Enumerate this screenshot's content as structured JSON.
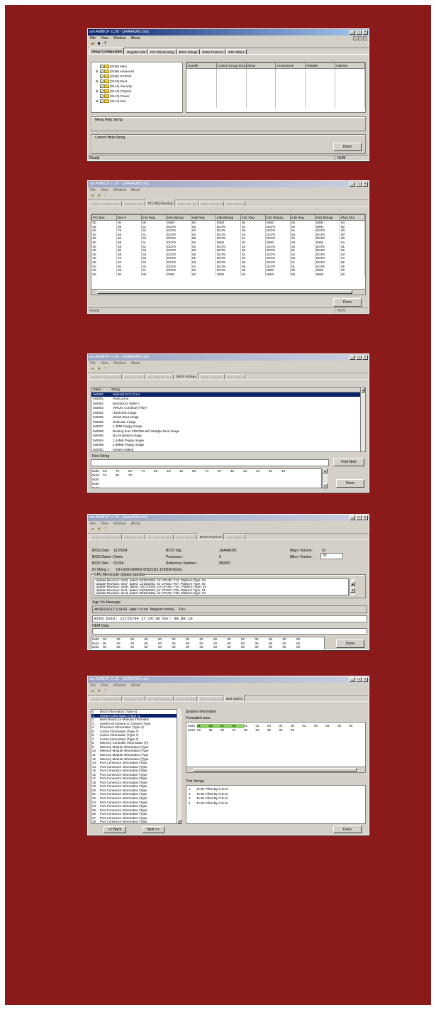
{
  "app": {
    "title": "ami AMIBCP v1.00 - [1AAAA000.rom]",
    "menu": [
      "File",
      "View",
      "Window",
      "About"
    ],
    "tabs": [
      "Setup Configuration",
      "Register Edit",
      "PCI IRQ Routing",
      "BIOS Strings",
      "BIOS Features",
      "DMI Tables"
    ],
    "status_ready": "Ready",
    "status_num": "NUM",
    "done_label": "Done"
  },
  "win1": {
    "active_tab": 0,
    "tree": [
      {
        "label": "(0190) Main",
        "checked": true
      },
      {
        "label": "(0196) Advanced",
        "checked": true
      },
      {
        "label": "(019F) PCIPnP",
        "checked": true
      },
      {
        "label": "(01A0) Boot",
        "checked": true
      },
      {
        "label": "(01A1) Security",
        "checked": true
      },
      {
        "label": "(01A2) Chipset",
        "checked": true
      },
      {
        "label": "(01A3) Power",
        "checked": true
      },
      {
        "label": "(01A4) Exit",
        "checked": true
      }
    ],
    "columns": [
      "Handle",
      "Control Group Structure",
      "Show",
      "Access/Use",
      "Failsafe",
      "Optimal"
    ],
    "menu_help_label": "Menu Help String",
    "control_help_label": "Control Help String"
  },
  "win2": {
    "active_tab": 2,
    "columns": [
      "PCI Bus",
      "Dev #",
      "IntA Reg",
      "IntA Bitmap",
      "IntB Reg",
      "IntB Bitmap",
      "IntC Reg",
      "IntC Bitmap",
      "IntD Reg",
      "IntD Bitmap",
      "Phys Slot"
    ],
    "rows": [
      [
        "00",
        "00",
        "00",
        "0000",
        "00",
        "0000",
        "00",
        "0000",
        "00",
        "0000",
        "00"
      ],
      [
        "00",
        "08",
        "01",
        "DCF8",
        "02",
        "DCF8",
        "03",
        "DCF8",
        "00",
        "0000",
        "00"
      ],
      [
        "00",
        "78",
        "02",
        "DCF8",
        "03",
        "DCF8",
        "05",
        "DCF8",
        "01",
        "DCF8",
        "00"
      ],
      [
        "00",
        "68",
        "01",
        "DCF8",
        "02",
        "DCF8",
        "03",
        "DCF8",
        "05",
        "DCF8",
        "00"
      ],
      [
        "00",
        "90",
        "03",
        "DCF8",
        "05",
        "DCF8",
        "01",
        "DCF8",
        "02",
        "DCF8",
        "00"
      ],
      [
        "00",
        "58",
        "01",
        "DCF8",
        "00",
        "0000",
        "00",
        "0000",
        "00",
        "0000",
        "00"
      ],
      [
        "00",
        "28",
        "01",
        "DCF8",
        "02",
        "DCF8",
        "03",
        "DCF8",
        "05",
        "DCF8",
        "01"
      ],
      [
        "00",
        "30",
        "02",
        "DCF8",
        "03",
        "DCF8",
        "05",
        "DCF8",
        "01",
        "DCF8",
        "02"
      ],
      [
        "00",
        "38",
        "03",
        "DCF8",
        "05",
        "DCF8",
        "01",
        "DCF8",
        "02",
        "DCF8",
        "03"
      ],
      [
        "00",
        "40",
        "05",
        "DCF8",
        "01",
        "DCF8",
        "02",
        "DCF8",
        "03",
        "DCF8",
        "04"
      ],
      [
        "00",
        "50",
        "02",
        "DCF8",
        "03",
        "DCF8",
        "05",
        "DCF8",
        "01",
        "DCF8",
        "05"
      ],
      [
        "00",
        "60",
        "02",
        "DCF8",
        "03",
        "DCF8",
        "05",
        "DCF8",
        "01",
        "DCF8",
        "05"
      ],
      [
        "00",
        "08",
        "01",
        "DCF8",
        "02",
        "DCF8",
        "00",
        "0000",
        "00",
        "0000",
        "00"
      ],
      [
        "00",
        "00",
        "00",
        "0000",
        "00",
        "0000",
        "00",
        "0000",
        "00",
        "0000",
        "00"
      ]
    ]
  },
  "win3": {
    "active_tab": 3,
    "columns": [
      "Token",
      "String"
    ],
    "strings": [
      [
        "0x0000",
        "Multi-Bit ECC Error"
      ],
      [
        "0x0001",
        "Parity Error"
      ],
      [
        "0x0002",
        "  BootSector Write !!"
      ],
      [
        "0x0003",
        "  VIRUS: Continue (Y/N)?"
      ],
      [
        "0x0004",
        "Hard Disk Image"
      ],
      [
        "0x0005",
        "Select Boot Image"
      ],
      [
        "0x0006",
        "Unknown Image"
      ],
      [
        "0x0007",
        "1.2MB Floppy Image"
      ],
      [
        "0x0008",
        "Booting from CDROM with Multiple Boot Image"
      ],
      [
        "0x0009",
        "No Emulation Image"
      ],
      [
        "0x000A",
        "1.44MB Floppy Image"
      ],
      [
        "0x000B",
        "2.88MB Floppy Image"
      ],
      [
        "0x000C",
        "System Halted"
      ],
      [
        "0x000D",
        "Reboot and Select proper Boot device or Insert Boot Media in selected Boot device and press a key"
      ],
      [
        "0x000E",
        "DRAM Frequency"
      ]
    ],
    "find_label": "Find String",
    "find_next_label": "Find Next",
    "hex": [
      [
        "0x00",
        "4D",
        "75",
        "6C",
        "74",
        "69",
        "2D",
        "42",
        "69",
        "74",
        "20",
        "45",
        "43",
        "43",
        "20",
        "45"
      ],
      [
        "0x10",
        "72",
        "6F",
        "72",
        "",
        "",
        "",
        "",
        "",
        "",
        "",
        "",
        "",
        "",
        "",
        ""
      ],
      [
        "0x20",
        "",
        "",
        "",
        "",
        "",
        "",
        "",
        "",
        "",
        "",
        "",
        "",
        "",
        "",
        ""
      ],
      [
        "0x30",
        "",
        "",
        "",
        "",
        "",
        "",
        "",
        "",
        "",
        "",
        "",
        "",
        "",
        "",
        ""
      ],
      [
        "0x40",
        "",
        "",
        "",
        "",
        "",
        "",
        "",
        "",
        "",
        "",
        "",
        "",
        "",
        "",
        ""
      ],
      [
        "0x50",
        "",
        "",
        "",
        "",
        "",
        "",
        "",
        "",
        "",
        "",
        "",
        "",
        "",
        "",
        ""
      ],
      [
        "0x60",
        "",
        "",
        "",
        "",
        "",
        "",
        "",
        "",
        "",
        "",
        "",
        "",
        "",
        "",
        ""
      ],
      [
        "0x70",
        "",
        "",
        "",
        "",
        "",
        "",
        "",
        "",
        "",
        "",
        "",
        "",
        "",
        "",
        ""
      ]
    ]
  },
  "win4": {
    "title": "ami AMIBCP v1.00 - [1aaaa000.rom]",
    "active_tab": 4,
    "bios_date_label": "BIOS Date :",
    "bios_date": "12/25/04",
    "bios_tag_label": "BIOS Tag :",
    "bios_tag": "1AAAA000",
    "major_label": "Major Version :",
    "major": "01",
    "bios_name_label": "BIOS Name :",
    "bios_name": "Demo",
    "processor_label": "Processor :",
    "processor": "6",
    "minor_label": "Minor Version :",
    "minor": "00",
    "bios_size_label": "BIOS Size :",
    "bios_size": "512Kb",
    "ref_label": "Reference Number :",
    "ref": "000001",
    "id_label": "ID String 1 :",
    "id_string": "63-0100-000001-00101111-122504-Demo",
    "cpu_group": "CPU Microcode Update patches",
    "cpu_lines": [
      "Update Revision: 0x03, dated: 02/06/2003, for CPUID: F13, Platform Type: 04",
      "Update Revision: 0x07, dated: 11/15/2002, for CPUID: F07, Platform Type: 04",
      "Update Revision: 0x0E, dated: 02/27/2002, for CPUID: F0A, Platform Type: 04",
      "Update Revision: 0x11, dated: 04/04/2003, for CPUID: F29, Platform Type: 04",
      "Update Revision: 0x13, dated: 05/01/2003, for CPUID: F25, Platform Type: 04"
    ],
    "signon_label": "Sign On Message",
    "signon1": "AMIBIOS(C)2003 American Megatrends, Inc.",
    "signon2": "BIOS Date: 12/25/04 17:24:38 Ver: 08.00.10",
    "oem_label": "OEM Data",
    "hex": [
      [
        "0x00",
        "00",
        "00",
        "00",
        "00",
        "00",
        "00",
        "00",
        "00",
        "00",
        "00",
        "00",
        "00",
        "00",
        "00",
        "00"
      ],
      [
        "0x10",
        "00",
        "00",
        "00",
        "00",
        "00",
        "00",
        "00",
        "00",
        "00",
        "00",
        "00",
        "00",
        "00",
        "00",
        "00"
      ],
      [
        "0x20",
        "00",
        "00",
        "00",
        "00",
        "00",
        "00",
        "00",
        "00",
        "00",
        "00",
        "00",
        "00",
        "00",
        "00",
        "00"
      ]
    ]
  },
  "win5": {
    "active_tab": 5,
    "list": [
      [
        "0",
        "BIOS Information  (Type 0)"
      ],
      [
        "1",
        "System Information  (Type 1)"
      ],
      [
        "2",
        "Base Board (or Module) Informatio"
      ],
      [
        "3",
        "System Enclosure or Chassis  (Type"
      ],
      [
        "4",
        "Processor Information  (Type 4)"
      ],
      [
        "5",
        "Cache Information  (Type 7)"
      ],
      [
        "6",
        "Cache Information  (Type 7)"
      ],
      [
        "7",
        "Cache Information  (Type 7)"
      ],
      [
        "8",
        "Memory Controller Information  (Ty"
      ],
      [
        "9",
        "Memory Module Information  (Type"
      ],
      [
        "10",
        "Memory Module Information  (Type"
      ],
      [
        "11",
        "Memory Module Information  (Type"
      ],
      [
        "12",
        "Memory Module Information  (Type"
      ],
      [
        "13",
        "Port Connector Information  (Type"
      ],
      [
        "14",
        "Port Connector Information  (Type"
      ],
      [
        "15",
        "Port Connector Information  (Type"
      ],
      [
        "16",
        "Port Connector Information  (Type"
      ],
      [
        "17",
        "Port Connector Information  (Type"
      ],
      [
        "18",
        "Port Connector Information  (Type"
      ],
      [
        "19",
        "Port Connector Information  (Type"
      ],
      [
        "20",
        "Port Connector Information  (Type"
      ],
      [
        "21",
        "Port Connector Information  (Type"
      ],
      [
        "22",
        "Port Connector Information  (Type"
      ],
      [
        "23",
        "Port Connector Information  (Type"
      ],
      [
        "24",
        "Port Connector Information  (Type"
      ],
      [
        "25",
        "Port Connector Information  (Type"
      ],
      [
        "26",
        "Port Connector Information  (Type"
      ],
      [
        "27",
        "Port Connector Information  (Type"
      ],
      [
        "28",
        "Port Connector Information  (Type"
      ]
    ],
    "selected": 1,
    "section_label": "System Information",
    "formatted_label": "Formatted area",
    "hex": [
      [
        "0x00",
        "01",
        "1B",
        "01",
        "00",
        "01",
        "02",
        "03",
        "04",
        "00",
        "02",
        "00",
        "03",
        "00",
        "04"
      ],
      [
        "0x10",
        "00",
        "06",
        "00",
        "07",
        "00",
        "00",
        "00",
        "05",
        "06",
        "",
        "",
        "",
        "",
        ""
      ]
    ],
    "text_label": "Text Strings",
    "text_strings": [
      [
        "1",
        "To Be Filled By O.E.M."
      ],
      [
        "2",
        "To Be Filled By O.E.M."
      ],
      [
        "3",
        "To Be Filled By O.E.M."
      ],
      [
        "4",
        "To Be Filled By O.E.M."
      ]
    ],
    "back_label": "<< Back",
    "next_label": "Next >>"
  }
}
